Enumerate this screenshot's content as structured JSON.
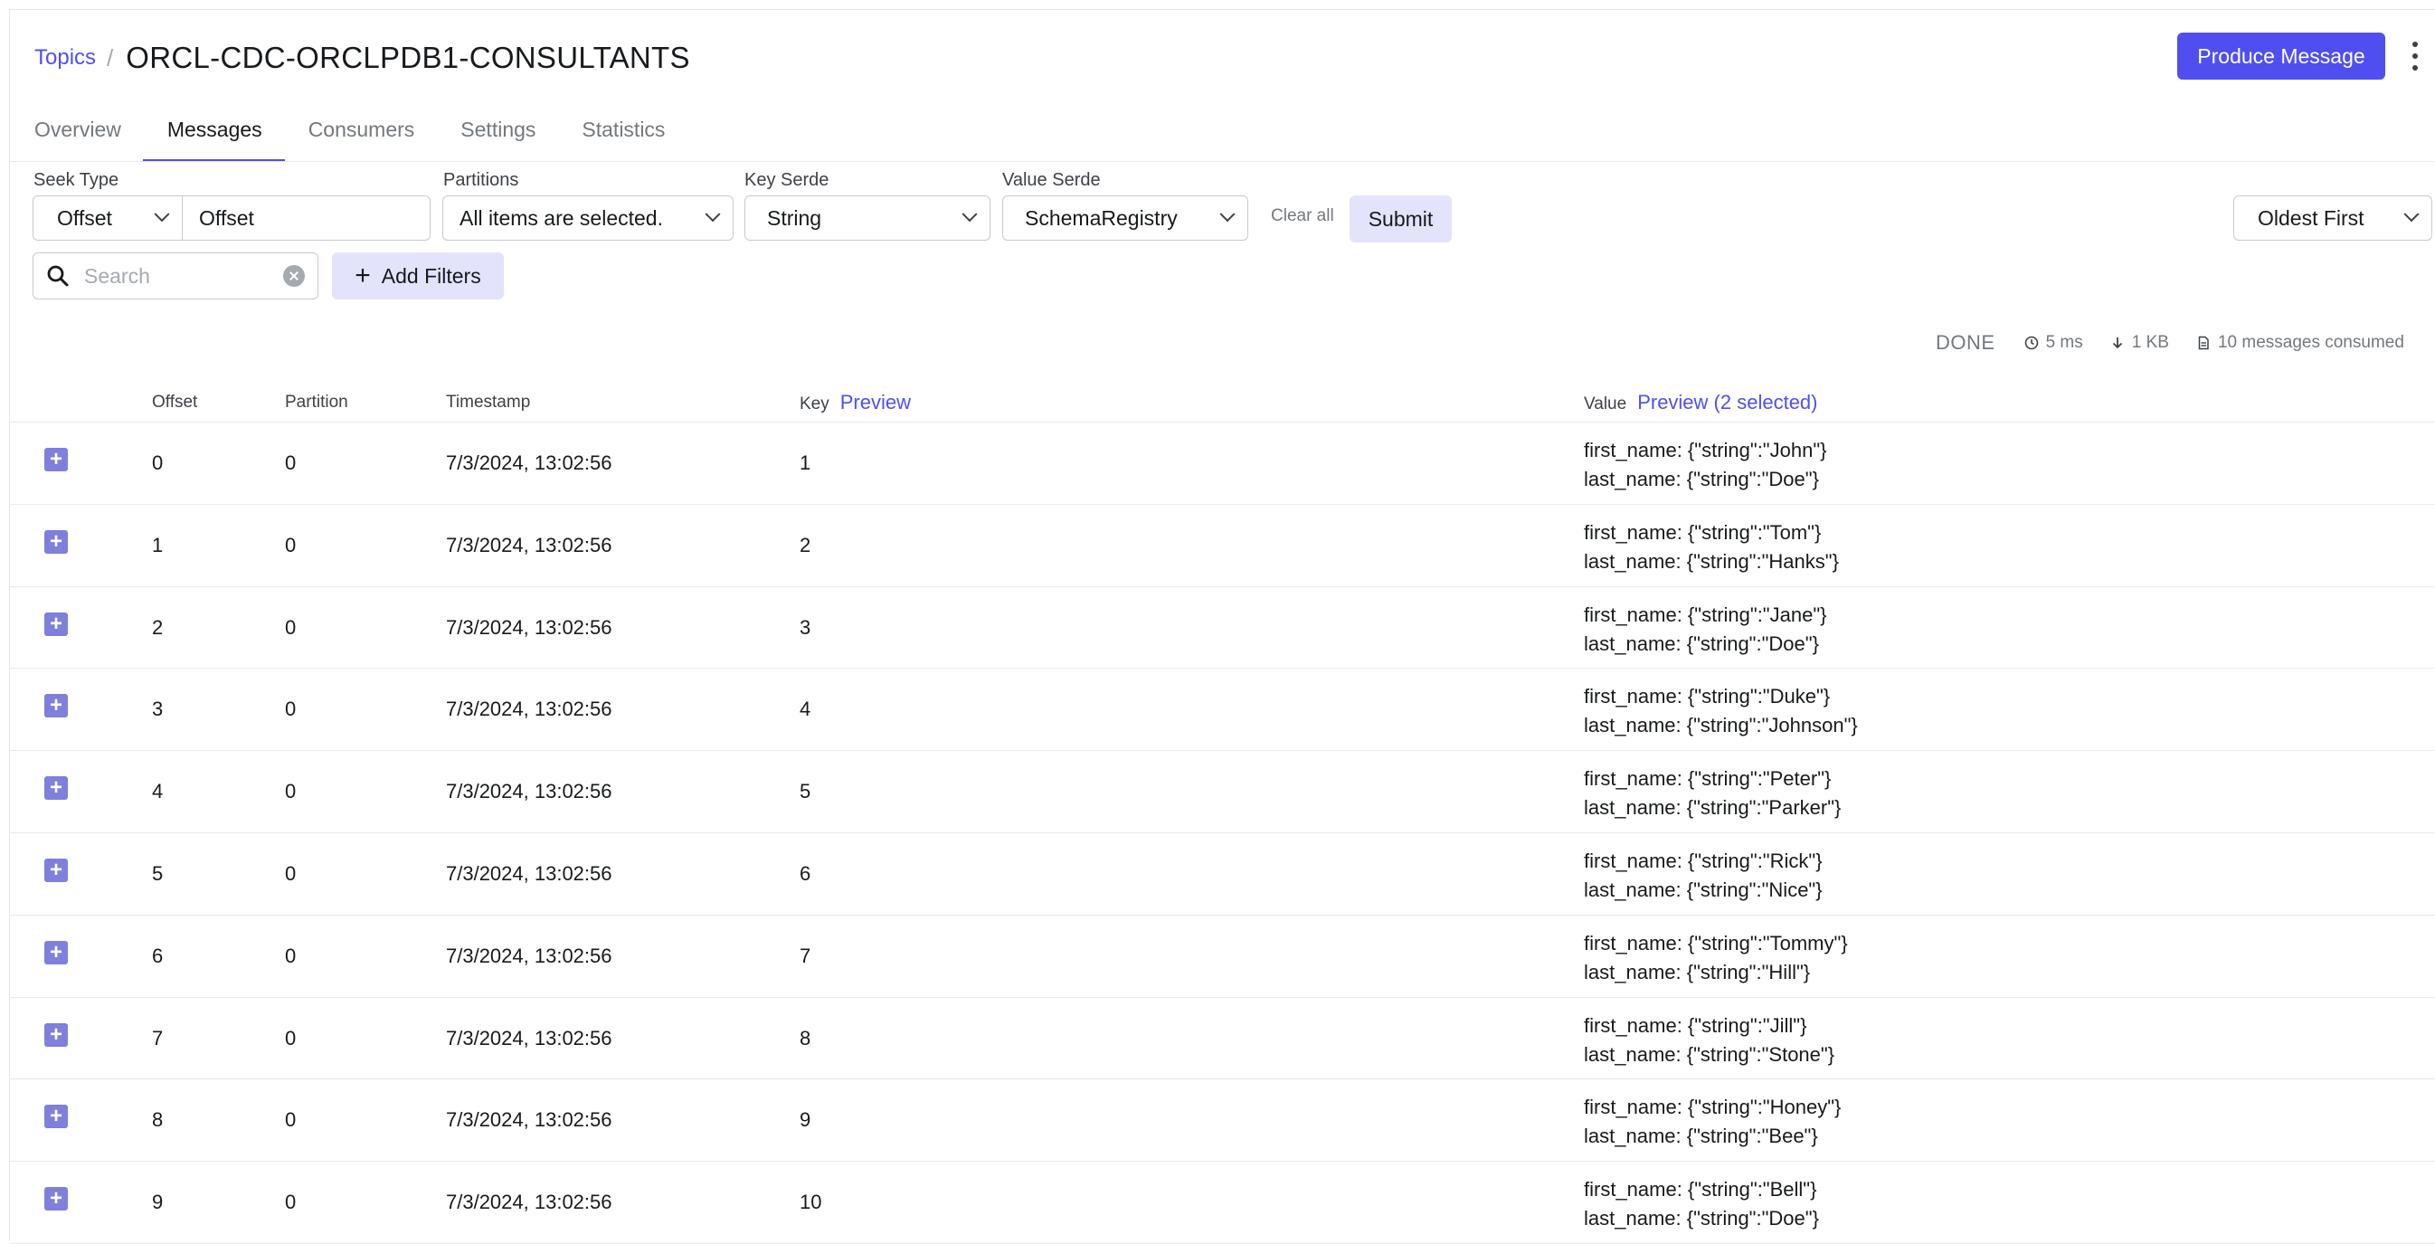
{
  "header": {
    "breadcrumb": "Topics",
    "separator": "/",
    "title": "ORCL-CDC-ORCLPDB1-CONSULTANTS",
    "produce_label": "Produce Message"
  },
  "tabs": [
    {
      "label": "Overview"
    },
    {
      "label": "Messages",
      "active": true
    },
    {
      "label": "Consumers"
    },
    {
      "label": "Settings"
    },
    {
      "label": "Statistics"
    }
  ],
  "filters": {
    "seek_type_label": "Seek Type",
    "seek_type_value": "Offset",
    "seek_input_value": "Offset",
    "partitions_label": "Partitions",
    "partitions_value": "All items are selected.",
    "key_serde_label": "Key Serde",
    "key_serde_value": "String",
    "value_serde_label": "Value Serde",
    "value_serde_value": "SchemaRegistry",
    "clear_all": "Clear all",
    "submit": "Submit",
    "sort_value": "Oldest First",
    "search_placeholder": "Search",
    "add_filters": "Add Filters"
  },
  "status": {
    "state": "DONE",
    "elapsed": "5 ms",
    "bytes": "1 KB",
    "consumed": "10 messages consumed"
  },
  "table": {
    "columns": {
      "offset": "Offset",
      "partition": "Partition",
      "timestamp": "Timestamp",
      "key": "Key",
      "key_preview": "Preview",
      "value": "Value",
      "value_preview": "Preview (2 selected)"
    },
    "rows": [
      {
        "offset": "0",
        "partition": "0",
        "timestamp": "7/3/2024, 13:02:56",
        "key": "1",
        "value_line1": "first_name: {\"string\":\"John\"}",
        "value_line2": "last_name: {\"string\":\"Doe\"}"
      },
      {
        "offset": "1",
        "partition": "0",
        "timestamp": "7/3/2024, 13:02:56",
        "key": "2",
        "value_line1": "first_name: {\"string\":\"Tom\"}",
        "value_line2": "last_name: {\"string\":\"Hanks\"}"
      },
      {
        "offset": "2",
        "partition": "0",
        "timestamp": "7/3/2024, 13:02:56",
        "key": "3",
        "value_line1": "first_name: {\"string\":\"Jane\"}",
        "value_line2": "last_name: {\"string\":\"Doe\"}"
      },
      {
        "offset": "3",
        "partition": "0",
        "timestamp": "7/3/2024, 13:02:56",
        "key": "4",
        "value_line1": "first_name: {\"string\":\"Duke\"}",
        "value_line2": "last_name: {\"string\":\"Johnson\"}"
      },
      {
        "offset": "4",
        "partition": "0",
        "timestamp": "7/3/2024, 13:02:56",
        "key": "5",
        "value_line1": "first_name: {\"string\":\"Peter\"}",
        "value_line2": "last_name: {\"string\":\"Parker\"}"
      },
      {
        "offset": "5",
        "partition": "0",
        "timestamp": "7/3/2024, 13:02:56",
        "key": "6",
        "value_line1": "first_name: {\"string\":\"Rick\"}",
        "value_line2": "last_name: {\"string\":\"Nice\"}"
      },
      {
        "offset": "6",
        "partition": "0",
        "timestamp": "7/3/2024, 13:02:56",
        "key": "7",
        "value_line1": "first_name: {\"string\":\"Tommy\"}",
        "value_line2": "last_name: {\"string\":\"Hill\"}"
      },
      {
        "offset": "7",
        "partition": "0",
        "timestamp": "7/3/2024, 13:02:56",
        "key": "8",
        "value_line1": "first_name: {\"string\":\"Jill\"}",
        "value_line2": "last_name: {\"string\":\"Stone\"}"
      },
      {
        "offset": "8",
        "partition": "0",
        "timestamp": "7/3/2024, 13:02:56",
        "key": "9",
        "value_line1": "first_name: {\"string\":\"Honey\"}",
        "value_line2": "last_name: {\"string\":\"Bee\"}"
      },
      {
        "offset": "9",
        "partition": "0",
        "timestamp": "7/3/2024, 13:02:56",
        "key": "10",
        "value_line1": "first_name: {\"string\":\"Bell\"}",
        "value_line2": "last_name: {\"string\":\"Doe\"}"
      }
    ]
  },
  "colors": {
    "accent": "#4f4ff0",
    "accent_light": "#e3e3fc",
    "expand_icon": "#7f7fdc",
    "muted_text": "#73787e",
    "border": "#c6cacf"
  },
  "icons": {
    "row_expand": "plus-square-icon",
    "search": "search-icon",
    "clear": "clear-circle-icon",
    "add": "plus-icon",
    "elapsed": "clock-icon",
    "bytes": "arrow-down-icon",
    "consumed": "document-icon",
    "more": "kebab-menu-icon"
  }
}
